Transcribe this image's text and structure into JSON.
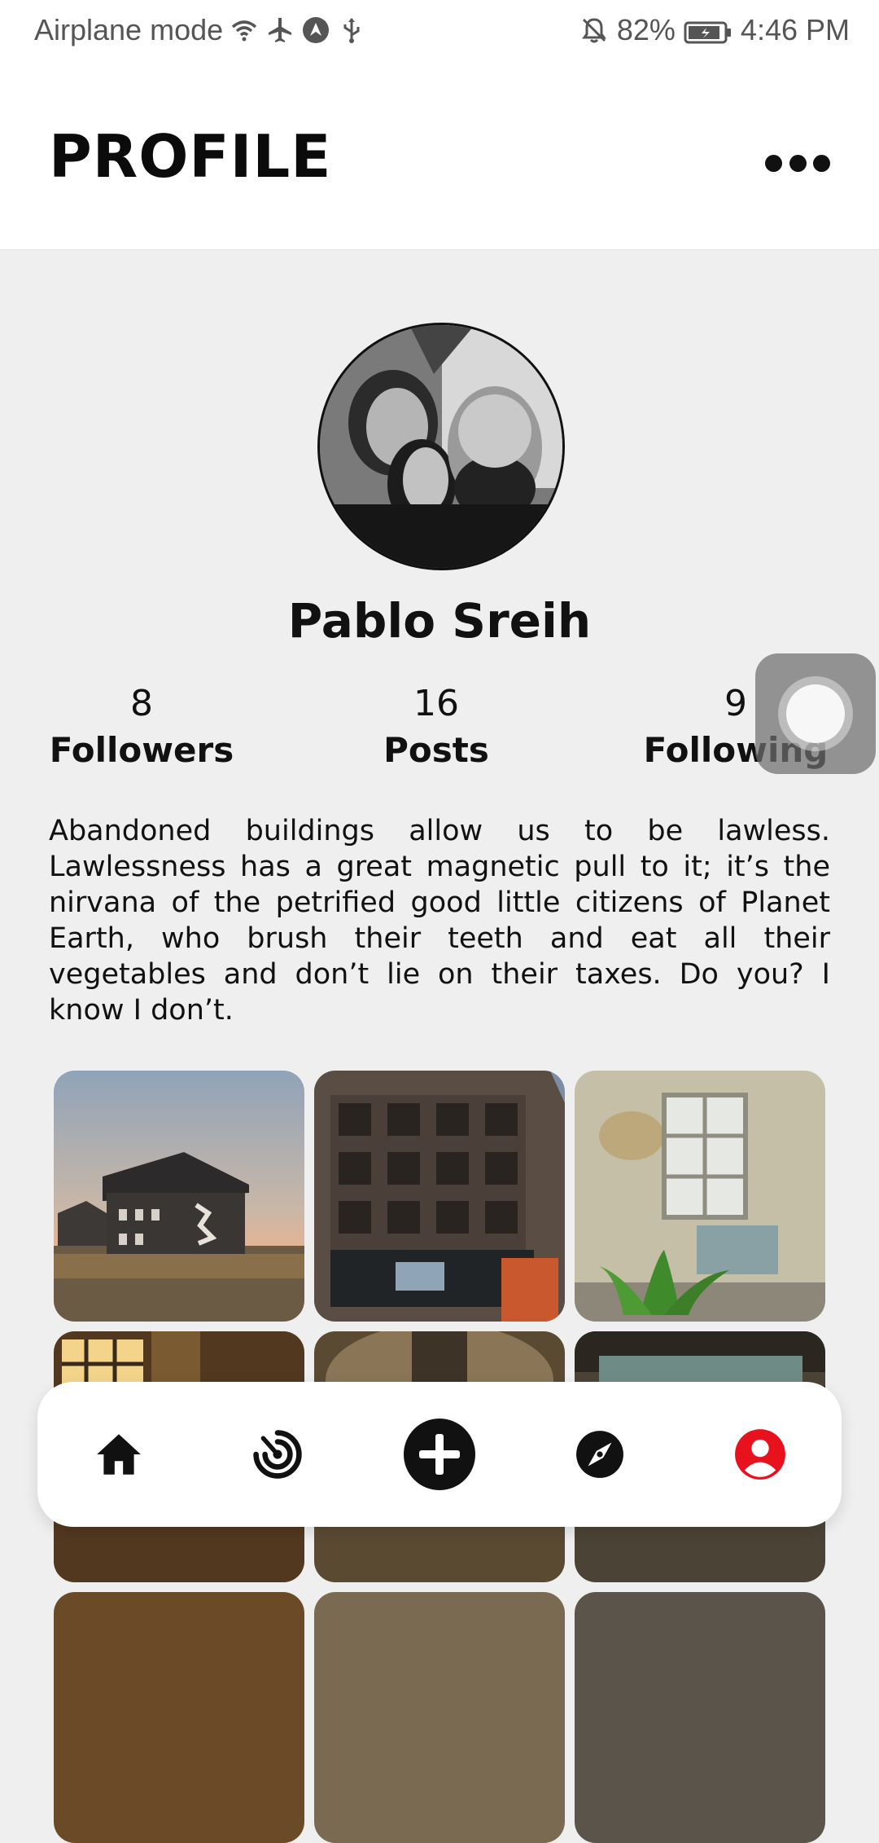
{
  "status_bar": {
    "left_text": "Airplane mode",
    "battery": "82%",
    "time": "4:46 PM",
    "icons_left": [
      "wifi-icon",
      "airplane-icon",
      "nav-app-icon",
      "usb-icon"
    ],
    "icons_right": [
      "bell-off-icon",
      "battery-charging-icon"
    ]
  },
  "header": {
    "title": "PROFILE",
    "more_icon": "more-horizontal-icon"
  },
  "profile": {
    "name": "Pablo Sreih",
    "avatar": "avatar-photo"
  },
  "stats": {
    "followers": {
      "value": "8",
      "label": "Followers"
    },
    "posts": {
      "value": "16",
      "label": "Posts"
    },
    "following": {
      "value": "9",
      "label": "Following"
    }
  },
  "bio": "Abandoned buildings allow us to be lawless. Lawlessness has a great magnetic pull to it; it’s the nirvana of the petrified good little citizens of Planet Earth, who brush their teeth and eat all their vegetables and don’t lie on their taxes. Do you? I know I don’t.",
  "bottom_nav": {
    "items": [
      "home-icon",
      "activity-icon",
      "add-icon",
      "explore-icon",
      "profile-icon"
    ],
    "active": "profile-icon"
  },
  "colors": {
    "active_nav": "#e8121f",
    "background": "#efefef",
    "text": "#111111"
  }
}
